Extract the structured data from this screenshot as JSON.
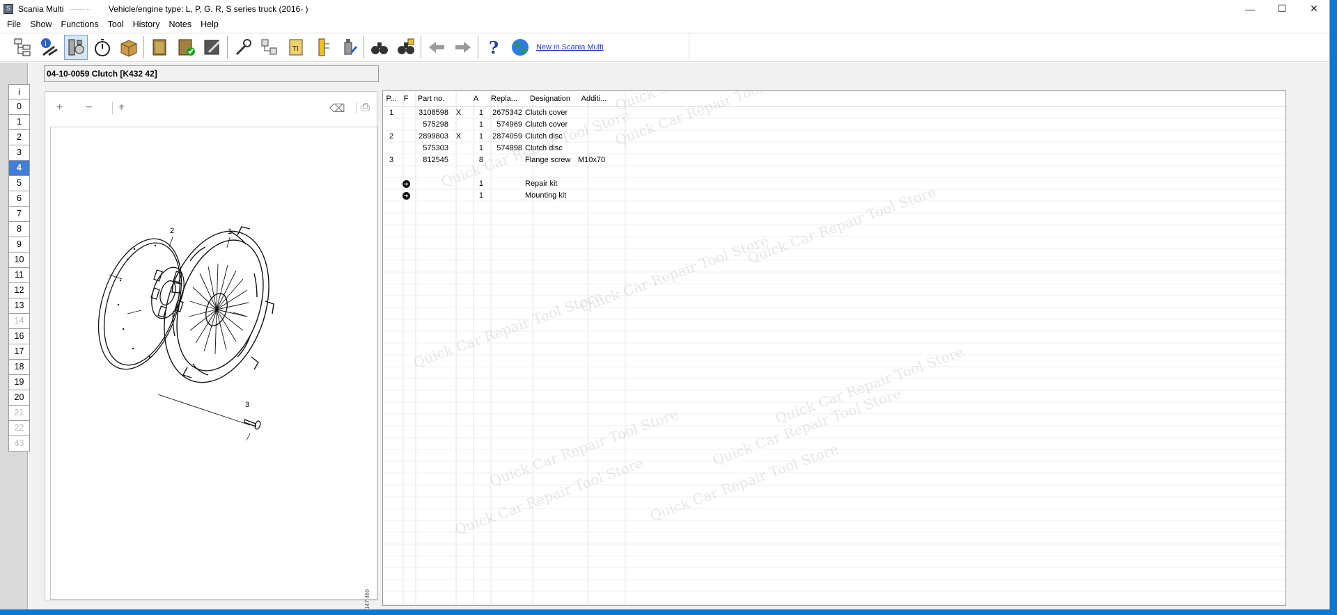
{
  "window": {
    "app_title": "Scania Multi",
    "app_sub": "–––– ··",
    "vehicle_type": "Vehicle/engine type: L, P, G, R, S series truck (2016- )",
    "minimize": "—",
    "maximize": "☐",
    "close": "✕"
  },
  "menu": [
    "File",
    "Show",
    "Functions",
    "Tool",
    "History",
    "Notes",
    "Help"
  ],
  "toolbar": {
    "whats_new_link": "New in Scania Multi"
  },
  "tabs": [
    "i",
    "0",
    "1",
    "2",
    "3",
    "4",
    "5",
    "6",
    "7",
    "8",
    "9",
    "10",
    "11",
    "12",
    "13",
    "14",
    "16",
    "17",
    "18",
    "19",
    "20",
    "21",
    "22",
    "43"
  ],
  "group_title": "04-10-0059 Clutch [K432 42]",
  "image_toolbar": {
    "zoom_in": "+",
    "zoom_out": "−",
    "fit": "⌖",
    "eraser": "⌫",
    "print": "⎙"
  },
  "drawing": {
    "ref": "147 460",
    "callouts": [
      "1",
      "2",
      "3"
    ]
  },
  "parts_table": {
    "headers": [
      "P...",
      "F",
      "Part no.",
      "",
      "A",
      "Repla...",
      "Designation",
      "Additi..."
    ],
    "rows": [
      {
        "pos": "1",
        "flag": "",
        "part": "3108598",
        "x": "X",
        "qty": "1",
        "rep": "2675342",
        "des": "Clutch cover",
        "add": ""
      },
      {
        "pos": "",
        "flag": "",
        "part": "575298",
        "x": "",
        "qty": "1",
        "rep": "574969",
        "des": "Clutch cover",
        "add": ""
      },
      {
        "pos": "2",
        "flag": "",
        "part": "2899803",
        "x": "X",
        "qty": "1",
        "rep": "2874059",
        "des": "Clutch disc",
        "add": ""
      },
      {
        "pos": "",
        "flag": "",
        "part": "575303",
        "x": "",
        "qty": "1",
        "rep": "574898",
        "des": "Clutch disc",
        "add": ""
      },
      {
        "pos": "3",
        "flag": "",
        "part": "812545",
        "x": "",
        "qty": "8",
        "rep": "",
        "des": "Flange screw",
        "add": "M10x70"
      },
      {
        "pos": "",
        "flag": "",
        "part": "",
        "x": "",
        "qty": "",
        "rep": "",
        "des": "",
        "add": ""
      },
      {
        "pos": "",
        "flag": "arrow",
        "part": "",
        "x": "",
        "qty": "1",
        "rep": "",
        "des": "Repair kit",
        "add": ""
      },
      {
        "pos": "",
        "flag": "arrow",
        "part": "",
        "x": "",
        "qty": "1",
        "rep": "",
        "des": "Mounting kit",
        "add": ""
      }
    ]
  },
  "watermark": "Quick Car Repair Tool Store",
  "colors": {
    "desktop": "#0a78d7",
    "active_tab": "#3f7fd8",
    "link": "#1a3dcc"
  }
}
